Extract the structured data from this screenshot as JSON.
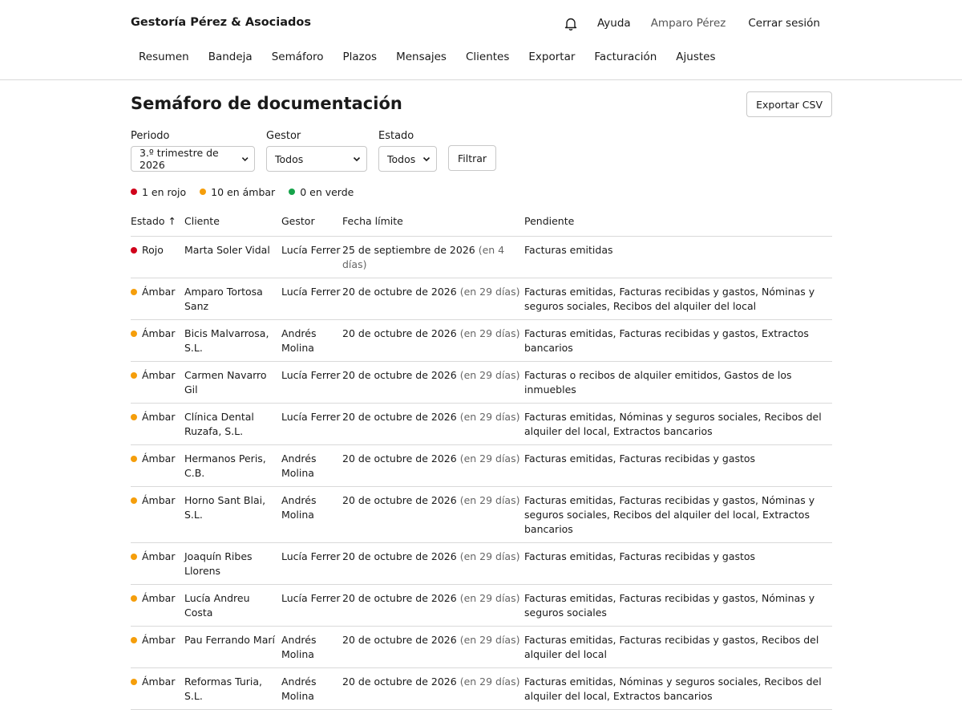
{
  "app": {
    "brand": "Gestoría Pérez & Asociados",
    "help": "Ayuda",
    "user": "Amparo Pérez",
    "logout": "Cerrar sesión"
  },
  "nav": [
    "Resumen",
    "Bandeja",
    "Semáforo",
    "Plazos",
    "Mensajes",
    "Clientes",
    "Exportar",
    "Facturación",
    "Ajustes"
  ],
  "page": {
    "title": "Semáforo de documentación",
    "export_label": "Exportar CSV"
  },
  "filters": {
    "periodo": {
      "label": "Periodo",
      "value": "3.º trimestre de 2026"
    },
    "gestor": {
      "label": "Gestor",
      "value": "Todos"
    },
    "estado": {
      "label": "Estado",
      "value": "Todos"
    },
    "button": "Filtrar"
  },
  "legend": {
    "red": "1 en rojo",
    "amber": "10 en ámbar",
    "green": "0 en verde"
  },
  "colors": {
    "red": "#d0021b",
    "amber": "#f59e0b",
    "green": "#16a34a"
  },
  "table": {
    "headers": [
      "Estado ↑",
      "Cliente",
      "Gestor",
      "Fecha límite",
      "Pendiente"
    ],
    "rows": [
      {
        "estado": "Rojo",
        "color": "red",
        "cliente": "Marta Soler Vidal",
        "gestor": "Lucía Ferrer",
        "fecha": "25 de septiembre de 2026",
        "rel": "(en 4 días)",
        "pendiente": "Facturas emitidas"
      },
      {
        "estado": "Ámbar",
        "color": "amber",
        "cliente": "Amparo Tortosa Sanz",
        "gestor": "Lucía Ferrer",
        "fecha": "20 de octubre de 2026",
        "rel": "(en 29 días)",
        "pendiente": "Facturas emitidas, Facturas recibidas y gastos, Nóminas y seguros sociales, Recibos del alquiler del local"
      },
      {
        "estado": "Ámbar",
        "color": "amber",
        "cliente": "Bicis Malvarrosa, S.L.",
        "gestor": "Andrés Molina",
        "fecha": "20 de octubre de 2026",
        "rel": "(en 29 días)",
        "pendiente": "Facturas emitidas, Facturas recibidas y gastos, Extractos bancarios"
      },
      {
        "estado": "Ámbar",
        "color": "amber",
        "cliente": "Carmen Navarro Gil",
        "gestor": "Lucía Ferrer",
        "fecha": "20 de octubre de 2026",
        "rel": "(en 29 días)",
        "pendiente": "Facturas o recibos de alquiler emitidos, Gastos de los inmuebles"
      },
      {
        "estado": "Ámbar",
        "color": "amber",
        "cliente": "Clínica Dental Ruzafa, S.L.",
        "gestor": "Lucía Ferrer",
        "fecha": "20 de octubre de 2026",
        "rel": "(en 29 días)",
        "pendiente": "Facturas emitidas, Nóminas y seguros sociales, Recibos del alquiler del local, Extractos bancarios"
      },
      {
        "estado": "Ámbar",
        "color": "amber",
        "cliente": "Hermanos Peris, C.B.",
        "gestor": "Andrés Molina",
        "fecha": "20 de octubre de 2026",
        "rel": "(en 29 días)",
        "pendiente": "Facturas emitidas, Facturas recibidas y gastos"
      },
      {
        "estado": "Ámbar",
        "color": "amber",
        "cliente": "Horno Sant Blai, S.L.",
        "gestor": "Andrés Molina",
        "fecha": "20 de octubre de 2026",
        "rel": "(en 29 días)",
        "pendiente": "Facturas emitidas, Facturas recibidas y gastos, Nóminas y seguros sociales, Recibos del alquiler del local, Extractos bancarios"
      },
      {
        "estado": "Ámbar",
        "color": "amber",
        "cliente": "Joaquín Ribes Llorens",
        "gestor": "Lucía Ferrer",
        "fecha": "20 de octubre de 2026",
        "rel": "(en 29 días)",
        "pendiente": "Facturas emitidas, Facturas recibidas y gastos"
      },
      {
        "estado": "Ámbar",
        "color": "amber",
        "cliente": "Lucía Andreu Costa",
        "gestor": "Lucía Ferrer",
        "fecha": "20 de octubre de 2026",
        "rel": "(en 29 días)",
        "pendiente": "Facturas emitidas, Facturas recibidas y gastos, Nóminas y seguros sociales"
      },
      {
        "estado": "Ámbar",
        "color": "amber",
        "cliente": "Pau Ferrando Marí",
        "gestor": "Andrés Molina",
        "fecha": "20 de octubre de 2026",
        "rel": "(en 29 días)",
        "pendiente": "Facturas emitidas, Facturas recibidas y gastos, Recibos del alquiler del local"
      },
      {
        "estado": "Ámbar",
        "color": "amber",
        "cliente": "Reformas Turia, S.L.",
        "gestor": "Andrés Molina",
        "fecha": "20 de octubre de 2026",
        "rel": "(en 29 días)",
        "pendiente": "Facturas emitidas, Nóminas y seguros sociales, Recibos del alquiler del local, Extractos bancarios"
      }
    ]
  }
}
